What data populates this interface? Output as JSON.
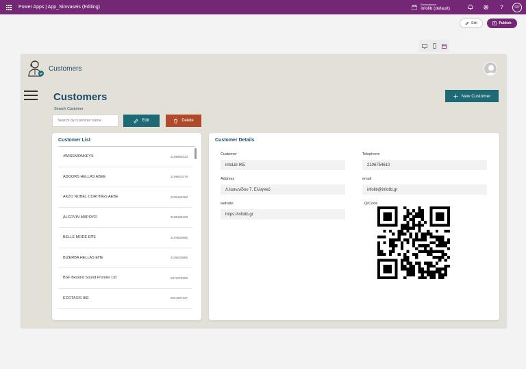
{
  "topbar": {
    "app_title": "Power Apps  |  App_Simvaseis (Editing)",
    "environment_label": "Environment",
    "environment_name": "infolib (default)",
    "user_initials": "OP"
  },
  "commandbar": {
    "edit_label": "Edit",
    "publish_label": "Publish"
  },
  "app": {
    "header_title": "Customers",
    "page_title": "Customers",
    "search_label": "Search Customer",
    "search_placeholder": "Search by customer name",
    "edit_button": "Edit",
    "delete_button": "Delete",
    "new_customer_button": "New Customer",
    "colors": {
      "accent": "#1d6a76",
      "danger": "#b04a2c",
      "title": "#1d4c6b",
      "brand": "#742774"
    }
  },
  "customer_list": {
    "title": "Customer List",
    "items": [
      {
        "name": "4WISEMONKEYS",
        "phone": "2106668123"
      },
      {
        "name": "ADOORS HELLAS ABEE",
        "phone": "2106623278"
      },
      {
        "name": "AKZO NOBEL COATINGS AEBE",
        "phone": "2106160180"
      },
      {
        "name": "ALCOVIN ΜΑΡΟΥΣΙ",
        "phone": "2106106403"
      },
      {
        "name": "BELLE MODE ΕΠΕ",
        "phone": "2104829565"
      },
      {
        "name": "BIZERBA HELLAS ΕΠΕ",
        "phone": "2106028886"
      },
      {
        "name": "BSF Beyond Sound Frontier Ltd",
        "phone": "6972079309"
      },
      {
        "name": "ECOTAXIS IKE",
        "phone": "6944227427"
      }
    ]
  },
  "details": {
    "title": "Customer Details",
    "customer_label": "Customer",
    "customer_value": "infoLib IKE",
    "telephone_label": "Telephone",
    "telephone_value": "2106754610",
    "address_label": "Address",
    "address_value": "Λ.Ιασωνίδου 7, Ελληνικό",
    "email_label": "email",
    "email_value": "infolib@infolib.gr",
    "website_label": "website",
    "website_value": "https://infolib.gr",
    "qrcode_label": "QrCode"
  },
  "icons": [
    "waffle-icon",
    "environment-icon",
    "bell-icon",
    "gear-icon",
    "help-icon",
    "pencil-icon",
    "publish-icon",
    "tablet-icon",
    "phone-icon",
    "calendar-icon",
    "customer-service-icon",
    "avatar-icon",
    "hamburger-icon",
    "trash-icon",
    "plus-icon",
    "qr-code"
  ]
}
